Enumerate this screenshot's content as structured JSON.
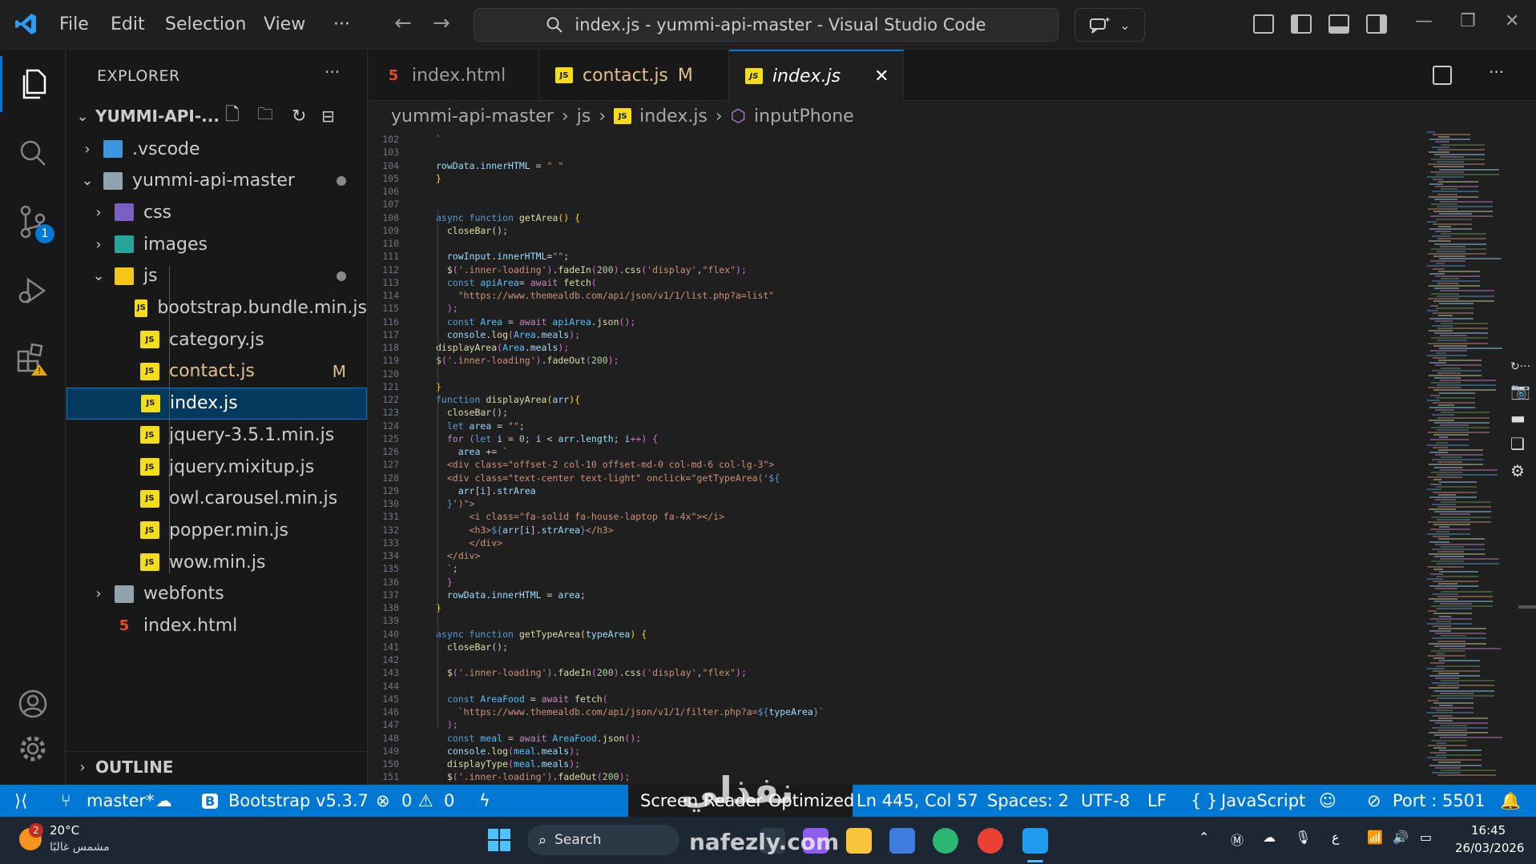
{
  "titlebar": {
    "menus": [
      "File",
      "Edit",
      "Selection",
      "View",
      "···"
    ],
    "command_center": "index.js - yummi-api-master - Visual Studio Code"
  },
  "sidebar": {
    "title": "EXPLORER",
    "more": "···",
    "root": "YUMMI-API-...",
    "tree": [
      {
        "label": ".vscode",
        "depth": 0,
        "kind": "folder",
        "chev": "›"
      },
      {
        "label": "yummi-api-master",
        "depth": 0,
        "kind": "folder",
        "chev": "⌄",
        "dot": true
      },
      {
        "label": "css",
        "depth": 1,
        "kind": "folder",
        "chev": "›"
      },
      {
        "label": "images",
        "depth": 1,
        "kind": "folder",
        "chev": "›"
      },
      {
        "label": "js",
        "depth": 1,
        "kind": "folder",
        "chev": "⌄",
        "dot": true
      },
      {
        "label": "bootstrap.bundle.min.js",
        "depth": 2,
        "kind": "js"
      },
      {
        "label": "category.js",
        "depth": 2,
        "kind": "js"
      },
      {
        "label": "contact.js",
        "depth": 2,
        "kind": "js",
        "mod": "M"
      },
      {
        "label": "index.js",
        "depth": 2,
        "kind": "js",
        "selected": true
      },
      {
        "label": "jquery-3.5.1.min.js",
        "depth": 2,
        "kind": "js"
      },
      {
        "label": "jquery.mixitup.js",
        "depth": 2,
        "kind": "js"
      },
      {
        "label": "owl.carousel.min.js",
        "depth": 2,
        "kind": "js"
      },
      {
        "label": "popper.min.js",
        "depth": 2,
        "kind": "js"
      },
      {
        "label": "wow.min.js",
        "depth": 2,
        "kind": "js"
      },
      {
        "label": "webfonts",
        "depth": 1,
        "kind": "folder",
        "chev": "›"
      },
      {
        "label": "index.html",
        "depth": 1,
        "kind": "html"
      }
    ],
    "outline": "OUTLINE",
    "scm_badge": "1"
  },
  "tabs": [
    {
      "label": "index.html",
      "icon": "html-icon"
    },
    {
      "label": "contact.js",
      "icon": "js-icon",
      "mod": "M"
    },
    {
      "label": "index.js",
      "icon": "js-icon",
      "active": true,
      "close": "✕"
    }
  ],
  "breadcrumb": [
    "yummi-api-master",
    "js",
    "index.js",
    "inputPhone"
  ],
  "code": [
    {
      "n": "102",
      "t": [
        [
          "`",
          "#ce9178"
        ]
      ]
    },
    {
      "n": "103",
      "t": []
    },
    {
      "n": "104",
      "t": [
        [
          "rowData",
          "#9cdcfe"
        ],
        [
          ".",
          "#cccccc"
        ],
        [
          "innerHTML",
          "#9cdcfe"
        ],
        [
          " = ",
          "#cccccc"
        ],
        [
          "\" \"",
          "#ce9178"
        ]
      ]
    },
    {
      "n": "105",
      "t": [
        [
          "}",
          "#ffd700"
        ]
      ]
    },
    {
      "n": "106",
      "t": []
    },
    {
      "n": "107",
      "t": []
    },
    {
      "n": "108",
      "t": [
        [
          "async ",
          "#569cd6"
        ],
        [
          "function ",
          "#569cd6"
        ],
        [
          "getArea",
          "#dcdcaa"
        ],
        [
          "() {",
          "#ffd700"
        ]
      ]
    },
    {
      "n": "109",
      "t": [
        [
          "  closeBar",
          "#dcdcaa"
        ],
        [
          "();",
          "#cccccc"
        ]
      ]
    },
    {
      "n": "110",
      "t": []
    },
    {
      "n": "111",
      "t": [
        [
          "  rowInput",
          "#9cdcfe"
        ],
        [
          ".",
          "#cccccc"
        ],
        [
          "innerHTML",
          "#9cdcfe"
        ],
        [
          "=",
          "#cccccc"
        ],
        [
          "\"\"",
          "#ce9178"
        ],
        [
          ";",
          "#cccccc"
        ]
      ]
    },
    {
      "n": "112",
      "t": [
        [
          "  $",
          "#dcdcaa"
        ],
        [
          "(",
          "#da70d6"
        ],
        [
          "'.inner-loading'",
          "#ce9178"
        ],
        [
          ")",
          "#da70d6"
        ],
        [
          ".",
          "#cccccc"
        ],
        [
          "fadeIn",
          "#dcdcaa"
        ],
        [
          "(",
          "#da70d6"
        ],
        [
          "200",
          "#b5cea8"
        ],
        [
          ")",
          "#da70d6"
        ],
        [
          ".",
          "#cccccc"
        ],
        [
          "css",
          "#dcdcaa"
        ],
        [
          "(",
          "#da70d6"
        ],
        [
          "'display'",
          "#ce9178"
        ],
        [
          ",",
          "#cccccc"
        ],
        [
          "\"flex\"",
          "#ce9178"
        ],
        [
          ");",
          "#da70d6"
        ]
      ]
    },
    {
      "n": "113",
      "t": [
        [
          "  const ",
          "#569cd6"
        ],
        [
          "apiArea",
          "#4fc1ff"
        ],
        [
          "= ",
          "#cccccc"
        ],
        [
          "await ",
          "#c586c0"
        ],
        [
          "fetch",
          "#dcdcaa"
        ],
        [
          "(",
          "#da70d6"
        ]
      ]
    },
    {
      "n": "114",
      "t": [
        [
          "    \"https://www.themealdb.com/api/json/v1/1/list.php?a=list\"",
          "#ce9178"
        ]
      ]
    },
    {
      "n": "115",
      "t": [
        [
          "  );",
          "#da70d6"
        ]
      ]
    },
    {
      "n": "116",
      "t": [
        [
          "  const ",
          "#569cd6"
        ],
        [
          "Area",
          "#4fc1ff"
        ],
        [
          " = ",
          "#cccccc"
        ],
        [
          "await ",
          "#c586c0"
        ],
        [
          "apiArea",
          "#4fc1ff"
        ],
        [
          ".",
          "#cccccc"
        ],
        [
          "json",
          "#dcdcaa"
        ],
        [
          "();",
          "#da70d6"
        ]
      ]
    },
    {
      "n": "117",
      "t": [
        [
          "  console",
          "#9cdcfe"
        ],
        [
          ".",
          "#cccccc"
        ],
        [
          "log",
          "#dcdcaa"
        ],
        [
          "(",
          "#da70d6"
        ],
        [
          "Area",
          "#4fc1ff"
        ],
        [
          ".",
          "#cccccc"
        ],
        [
          "meals",
          "#9cdcfe"
        ],
        [
          ");",
          "#da70d6"
        ]
      ]
    },
    {
      "n": "118",
      "t": [
        [
          "displayArea",
          "#dcdcaa"
        ],
        [
          "(",
          "#da70d6"
        ],
        [
          "Area",
          "#4fc1ff"
        ],
        [
          ".",
          "#cccccc"
        ],
        [
          "meals",
          "#9cdcfe"
        ],
        [
          ");",
          "#da70d6"
        ]
      ]
    },
    {
      "n": "119",
      "t": [
        [
          "$",
          "#dcdcaa"
        ],
        [
          "(",
          "#da70d6"
        ],
        [
          "'.inner-loading'",
          "#ce9178"
        ],
        [
          ")",
          "#da70d6"
        ],
        [
          ".",
          "#cccccc"
        ],
        [
          "fadeOut",
          "#dcdcaa"
        ],
        [
          "(",
          "#da70d6"
        ],
        [
          "200",
          "#b5cea8"
        ],
        [
          ");",
          "#da70d6"
        ]
      ]
    },
    {
      "n": "120",
      "t": []
    },
    {
      "n": "121",
      "t": [
        [
          "}",
          "#ffd700"
        ]
      ]
    },
    {
      "n": "122",
      "t": [
        [
          "function ",
          "#569cd6"
        ],
        [
          "displayArea",
          "#dcdcaa"
        ],
        [
          "(",
          "#ffd700"
        ],
        [
          "arr",
          "#9cdcfe"
        ],
        [
          "){",
          "#ffd700"
        ]
      ]
    },
    {
      "n": "123",
      "t": [
        [
          "  closeBar",
          "#dcdcaa"
        ],
        [
          "();",
          "#cccccc"
        ]
      ]
    },
    {
      "n": "124",
      "t": [
        [
          "  let ",
          "#569cd6"
        ],
        [
          "area",
          "#9cdcfe"
        ],
        [
          " = ",
          "#cccccc"
        ],
        [
          "\"\"",
          "#ce9178"
        ],
        [
          ";",
          "#cccccc"
        ]
      ]
    },
    {
      "n": "125",
      "t": [
        [
          "  for ",
          "#c586c0"
        ],
        [
          "(",
          "#da70d6"
        ],
        [
          "let ",
          "#569cd6"
        ],
        [
          "i",
          "#9cdcfe"
        ],
        [
          " = ",
          "#cccccc"
        ],
        [
          "0",
          "#b5cea8"
        ],
        [
          "; ",
          "#cccccc"
        ],
        [
          "i",
          "#9cdcfe"
        ],
        [
          " < ",
          "#cccccc"
        ],
        [
          "arr",
          "#9cdcfe"
        ],
        [
          ".",
          "#cccccc"
        ],
        [
          "length",
          "#9cdcfe"
        ],
        [
          "; ",
          "#cccccc"
        ],
        [
          "i",
          "#9cdcfe"
        ],
        [
          "++) {",
          "#da70d6"
        ]
      ]
    },
    {
      "n": "126",
      "t": [
        [
          "    area",
          "#9cdcfe"
        ],
        [
          " += ",
          "#cccccc"
        ],
        [
          "`",
          "#ce9178"
        ]
      ]
    },
    {
      "n": "127",
      "t": [
        [
          "  <div class=\"offset-2 col-10 offset-md-0 col-md-6 col-lg-3\">",
          "#ce9178"
        ]
      ]
    },
    {
      "n": "128",
      "t": [
        [
          "  <div class=\"text-center text-light\" onclick=\"getTypeArea('",
          "#ce9178"
        ],
        [
          "${",
          "#569cd6"
        ]
      ]
    },
    {
      "n": "129",
      "t": [
        [
          "    arr",
          "#9cdcfe"
        ],
        [
          "[",
          "#cccccc"
        ],
        [
          "i",
          "#9cdcfe"
        ],
        [
          "].",
          "#cccccc"
        ],
        [
          "strArea",
          "#9cdcfe"
        ]
      ]
    },
    {
      "n": "130",
      "t": [
        [
          "  }",
          "#569cd6"
        ],
        [
          "')\">",
          "#ce9178"
        ]
      ]
    },
    {
      "n": "131",
      "t": [
        [
          "      <i class=\"fa-solid fa-house-laptop fa-4x\"></i>",
          "#ce9178"
        ]
      ]
    },
    {
      "n": "132",
      "t": [
        [
          "      <h3>",
          "#ce9178"
        ],
        [
          "${",
          "#569cd6"
        ],
        [
          "arr",
          "#9cdcfe"
        ],
        [
          "[",
          "#cccccc"
        ],
        [
          "i",
          "#9cdcfe"
        ],
        [
          "].",
          "#cccccc"
        ],
        [
          "strArea",
          "#9cdcfe"
        ],
        [
          "}",
          "#569cd6"
        ],
        [
          "</h3>",
          "#ce9178"
        ]
      ]
    },
    {
      "n": "133",
      "t": [
        [
          "      </div>",
          "#ce9178"
        ]
      ]
    },
    {
      "n": "134",
      "t": [
        [
          "  </div>",
          "#ce9178"
        ]
      ]
    },
    {
      "n": "135",
      "t": [
        [
          "  `",
          "#ce9178"
        ],
        [
          ";",
          "#cccccc"
        ]
      ]
    },
    {
      "n": "136",
      "t": [
        [
          "  }",
          "#da70d6"
        ]
      ]
    },
    {
      "n": "137",
      "t": [
        [
          "  rowData",
          "#9cdcfe"
        ],
        [
          ".",
          "#cccccc"
        ],
        [
          "innerHTML",
          "#9cdcfe"
        ],
        [
          " = ",
          "#cccccc"
        ],
        [
          "area",
          "#9cdcfe"
        ],
        [
          ";",
          "#cccccc"
        ]
      ]
    },
    {
      "n": "138",
      "t": [
        [
          "}",
          "#ffd700"
        ]
      ]
    },
    {
      "n": "139",
      "t": []
    },
    {
      "n": "140",
      "t": [
        [
          "async ",
          "#569cd6"
        ],
        [
          "function ",
          "#569cd6"
        ],
        [
          "getTypeArea",
          "#dcdcaa"
        ],
        [
          "(",
          "#ffd700"
        ],
        [
          "typeArea",
          "#9cdcfe"
        ],
        [
          ") {",
          "#ffd700"
        ]
      ]
    },
    {
      "n": "141",
      "t": [
        [
          "  closeBar",
          "#dcdcaa"
        ],
        [
          "();",
          "#cccccc"
        ]
      ]
    },
    {
      "n": "142",
      "t": []
    },
    {
      "n": "143",
      "t": [
        [
          "  $",
          "#dcdcaa"
        ],
        [
          "(",
          "#da70d6"
        ],
        [
          "'.inner-loading'",
          "#ce9178"
        ],
        [
          ")",
          "#da70d6"
        ],
        [
          ".",
          "#cccccc"
        ],
        [
          "fadeIn",
          "#dcdcaa"
        ],
        [
          "(",
          "#da70d6"
        ],
        [
          "200",
          "#b5cea8"
        ],
        [
          ")",
          "#da70d6"
        ],
        [
          ".",
          "#cccccc"
        ],
        [
          "css",
          "#dcdcaa"
        ],
        [
          "(",
          "#da70d6"
        ],
        [
          "'display'",
          "#ce9178"
        ],
        [
          ",",
          "#cccccc"
        ],
        [
          "\"flex\"",
          "#ce9178"
        ],
        [
          ");",
          "#da70d6"
        ]
      ]
    },
    {
      "n": "144",
      "t": []
    },
    {
      "n": "145",
      "t": [
        [
          "  const ",
          "#569cd6"
        ],
        [
          "AreaFood",
          "#4fc1ff"
        ],
        [
          " = ",
          "#cccccc"
        ],
        [
          "await ",
          "#c586c0"
        ],
        [
          "fetch",
          "#dcdcaa"
        ],
        [
          "(",
          "#da70d6"
        ]
      ]
    },
    {
      "n": "146",
      "t": [
        [
          "    `https://www.themealdb.com/api/json/v1/1/filter.php?a=",
          "#ce9178"
        ],
        [
          "${",
          "#569cd6"
        ],
        [
          "typeArea",
          "#9cdcfe"
        ],
        [
          "}",
          "#569cd6"
        ],
        [
          "`",
          "#ce9178"
        ]
      ]
    },
    {
      "n": "147",
      "t": [
        [
          "  );",
          "#da70d6"
        ]
      ]
    },
    {
      "n": "148",
      "t": [
        [
          "  const ",
          "#569cd6"
        ],
        [
          "meal",
          "#4fc1ff"
        ],
        [
          " = ",
          "#cccccc"
        ],
        [
          "await ",
          "#c586c0"
        ],
        [
          "AreaFood",
          "#4fc1ff"
        ],
        [
          ".",
          "#cccccc"
        ],
        [
          "json",
          "#dcdcaa"
        ],
        [
          "();",
          "#da70d6"
        ]
      ]
    },
    {
      "n": "149",
      "t": [
        [
          "  console",
          "#9cdcfe"
        ],
        [
          ".",
          "#cccccc"
        ],
        [
          "log",
          "#dcdcaa"
        ],
        [
          "(",
          "#da70d6"
        ],
        [
          "meal",
          "#4fc1ff"
        ],
        [
          ".",
          "#cccccc"
        ],
        [
          "meals",
          "#9cdcfe"
        ],
        [
          ");",
          "#da70d6"
        ]
      ]
    },
    {
      "n": "150",
      "t": [
        [
          "  displayType",
          "#dcdcaa"
        ],
        [
          "(",
          "#da70d6"
        ],
        [
          "meal",
          "#4fc1ff"
        ],
        [
          ".",
          "#cccccc"
        ],
        [
          "meals",
          "#9cdcfe"
        ],
        [
          ");",
          "#da70d6"
        ]
      ]
    },
    {
      "n": "151",
      "t": [
        [
          "  $",
          "#dcdcaa"
        ],
        [
          "(",
          "#da70d6"
        ],
        [
          "'.inner-loading'",
          "#ce9178"
        ],
        [
          ")",
          "#da70d6"
        ],
        [
          ".",
          "#cccccc"
        ],
        [
          "fadeOut",
          "#dcdcaa"
        ],
        [
          "(",
          "#da70d6"
        ],
        [
          "200",
          "#b5cea8"
        ],
        [
          ");",
          "#da70d6"
        ]
      ]
    }
  ],
  "statusbar": {
    "remote": "⟩⟨",
    "branch": "master*",
    "bootstrap": "Bootstrap v5.3.7",
    "errors": "0",
    "warnings": "0",
    "screen_reader": "Screen Reader Optimized",
    "cursor": "Ln 445, Col 57",
    "spaces": "Spaces: 2",
    "encoding": "UTF-8",
    "eol": "LF",
    "language": "JavaScript",
    "port": "Port : 5501"
  },
  "taskbar": {
    "weather_temp": "20°C",
    "weather_desc": "مشمس غالبًا",
    "weather_badge": "2",
    "search": "Search",
    "lang": "ع",
    "time": "16:45",
    "date": "26/03/2026"
  },
  "watermark": {
    "arabic": "نفذلي",
    "latin": "nafezly.com"
  },
  "colors": {
    "accent": "#0078d4",
    "statusbar": "#0078d4",
    "js_icon": "#f5de19",
    "modified": "#e2c08d"
  }
}
